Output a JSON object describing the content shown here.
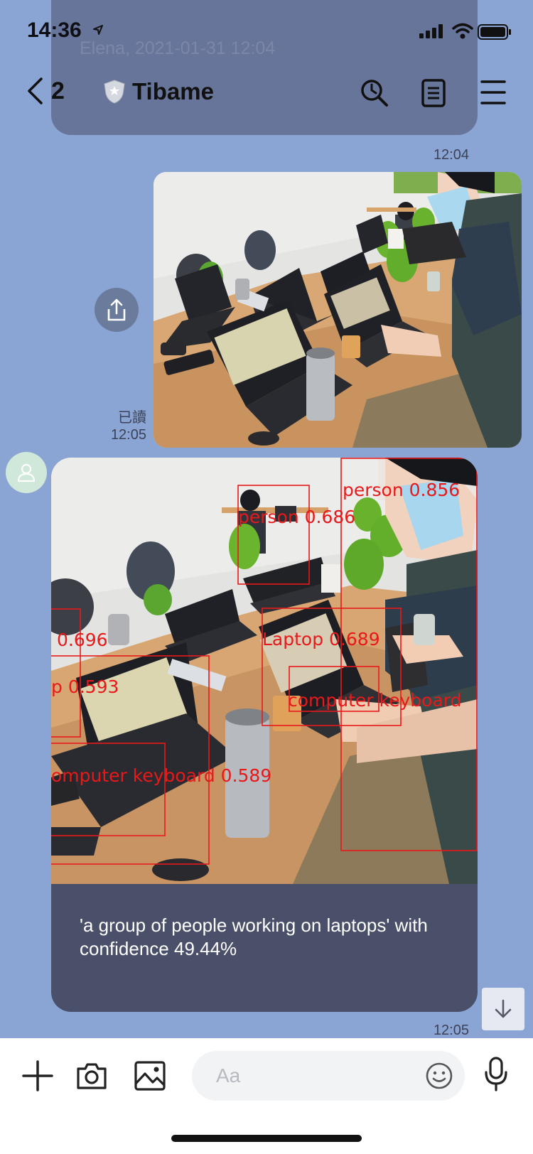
{
  "status_bar": {
    "time": "14:36"
  },
  "previous_message": {
    "text": "Elena, 2021-01-31 12:04",
    "time": "12:04"
  },
  "header": {
    "back_count": "2",
    "title": "Tibame"
  },
  "sent_photo": {
    "read_status": "已讀",
    "time": "12:05"
  },
  "reply": {
    "detections": [
      {
        "label": "person 0.856"
      },
      {
        "label": "person 0.686"
      },
      {
        "label": "0.696"
      },
      {
        "label": "Laptop 0.689"
      },
      {
        "label": "p 0.593"
      },
      {
        "label": "computer keyboard"
      },
      {
        "label": "omputer keyboard 0.589"
      }
    ],
    "caption": "'a group of people working on laptops' with confidence 49.44%",
    "time": "12:05"
  },
  "input": {
    "placeholder": "Aa"
  },
  "icons": {
    "location": "location-arrow-icon",
    "signal": "cellular-signal-icon",
    "wifi": "wifi-icon",
    "battery": "battery-icon",
    "back": "chevron-left-icon",
    "shield": "shield-star-icon",
    "search": "search-icon",
    "notes": "notes-icon",
    "menu": "hamburger-menu-icon",
    "share": "share-icon",
    "avatar": "user-avatar-icon",
    "scroll_down": "arrow-down-icon",
    "plus": "plus-icon",
    "camera": "camera-icon",
    "image": "image-icon",
    "emoji": "emoji-icon",
    "mic": "microphone-icon"
  },
  "colors": {
    "background": "#8aa4d4",
    "bubble": "#4a4f6a",
    "detection": "#e8191b",
    "input": "#f2f3f5"
  }
}
